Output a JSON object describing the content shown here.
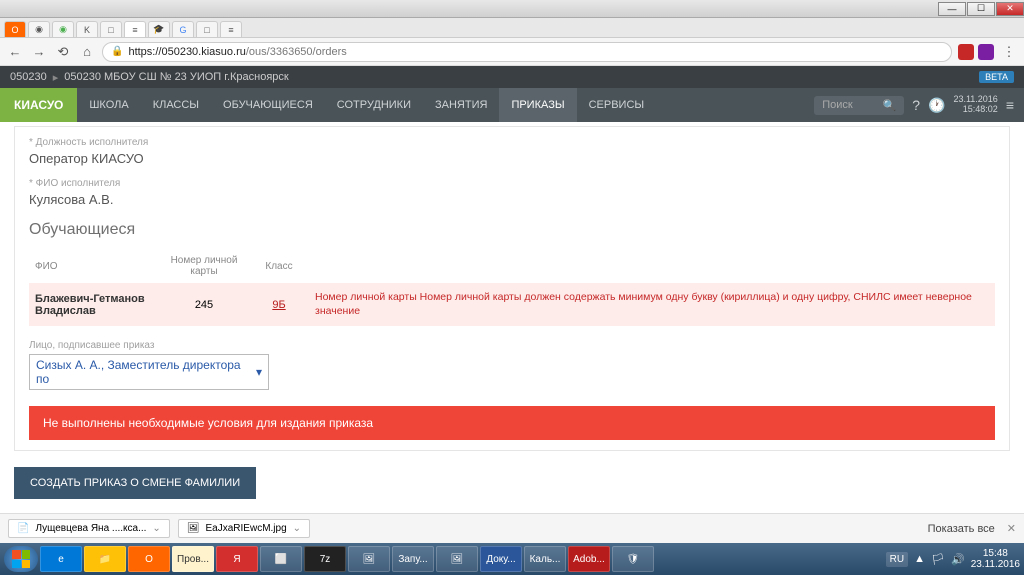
{
  "window": {
    "minimize": "—",
    "maximize": "☐",
    "close": "✕"
  },
  "browser": {
    "url_domain": "https://050230.kiasuo.ru",
    "url_path": "/ous/3363650/orders",
    "back": "←",
    "forward": "→",
    "reload": "⟲",
    "home": "⌂"
  },
  "breadcrumb": {
    "code": "050230",
    "school": "050230 МБОУ СШ № 23 УИОП г.Красноярск",
    "beta": "BETA"
  },
  "nav": {
    "logo": "КИАСУО",
    "items": [
      "ШКОЛА",
      "КЛАССЫ",
      "ОБУЧАЮЩИЕСЯ",
      "СОТРУДНИКИ",
      "ЗАНЯТИЯ",
      "ПРИКАЗЫ",
      "СЕРВИСЫ"
    ],
    "search_placeholder": "Поиск",
    "date": "23.11.2016",
    "time": "15:48:02"
  },
  "form": {
    "position_label": "* Должность исполнителя",
    "position_value": "Оператор КИАСУО",
    "fio_label": "* ФИО исполнителя",
    "fio_value": "Кулясова А.В.",
    "students_title": "Обучающиеся"
  },
  "table": {
    "headers": {
      "fio": "ФИО",
      "card": "Номер личной карты",
      "class": "Класс"
    },
    "row": {
      "name": "Блажевич-Гетманов Владислав",
      "card": "245",
      "class": "9Б",
      "error": "Номер личной карты Номер личной карты должен содержать минимум одну букву (кириллица) и одну цифру, СНИЛС имеет неверное значение"
    }
  },
  "signer": {
    "label": "Лицо, подписавшее приказ",
    "value": "Сизых А. А., Заместитель директора по "
  },
  "alert": "Не выполнены необходимые условия для издания приказа",
  "button": "СОЗДАТЬ ПРИКАЗ О СМЕНЕ ФАМИЛИИ",
  "downloads": {
    "item1": "Лущевцева Яна ....кса...",
    "item2": "EaJxaRIEwcM.jpg",
    "show_all": "Показать все"
  },
  "taskbar": {
    "apps": [
      "",
      "",
      "",
      "Пров...",
      "",
      "",
      "7z",
      "",
      "Запу...",
      "",
      "Доку...",
      "Каль...",
      "Adob...",
      ""
    ],
    "lang": "RU",
    "time": "15:48",
    "date": "23.11.2016"
  }
}
